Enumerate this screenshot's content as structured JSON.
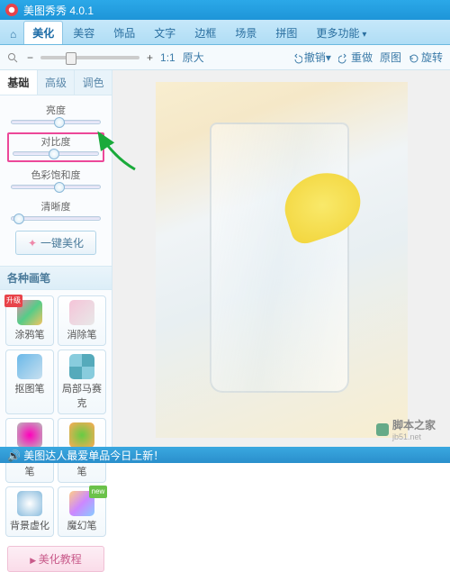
{
  "title": "美图秀秀 4.0.1",
  "tabs": {
    "home": "⌂",
    "t1": "美化",
    "t2": "美容",
    "t3": "饰品",
    "t4": "文字",
    "t5": "边框",
    "t6": "场景",
    "t7": "拼图",
    "t8": "更多功能"
  },
  "toolbar": {
    "zoom_out": "−",
    "zoom_in": "+",
    "ratio": "1:1",
    "orig": "原大",
    "undo": "撤销",
    "redo": "重做",
    "restore": "原图",
    "rotate": "旋转"
  },
  "subtabs": {
    "t1": "基础",
    "t2": "高级",
    "t3": "调色"
  },
  "sliders": {
    "brightness": "亮度",
    "contrast": "对比度",
    "saturation": "色彩饱和度",
    "sharpness": "清晰度"
  },
  "onekey": "一键美化",
  "brush_header": "各种画笔",
  "brushes": {
    "b1": "涂鸦笔",
    "b2": "消除笔",
    "b3": "抠图笔",
    "b4": "局部马赛克",
    "b5": "局部彩色笔",
    "b6": "局部变色笔",
    "b7": "背景虚化",
    "b8": "魔幻笔"
  },
  "tutorial": "美化教程",
  "status": "美图达人最爱单品今日上新！",
  "watermark": "脚本之家",
  "wm_url": "jb51.net"
}
